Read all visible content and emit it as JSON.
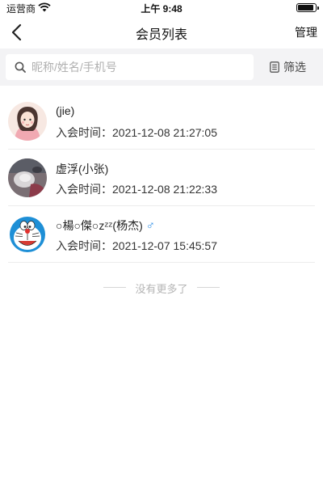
{
  "status_bar": {
    "carrier": "运营商",
    "time": "上午 9:48"
  },
  "nav": {
    "title": "会员列表",
    "manage_label": "管理"
  },
  "search": {
    "placeholder": "昵称/姓名/手机号",
    "value": "",
    "filter_label": "筛选"
  },
  "members": [
    {
      "name": "(jie)",
      "joined": "入会时间：2021-12-08 21:27:05",
      "avatar": "girl-illustration-avatar"
    },
    {
      "name": "虚浮(小张)",
      "joined": "入会时间：2021-12-08 21:22:33",
      "avatar": "photo-avatar"
    },
    {
      "name": "○楊○傑○zᶻᶻ(杨杰)",
      "gender": "♂",
      "joined": "入会时间：2021-12-07 15:45:57",
      "avatar": "doraemon-avatar"
    }
  ],
  "list_end_text": "没有更多了",
  "colors": {
    "gender_male": "#2f8fe6",
    "search_bar_bg": "#f3f3f5",
    "divider": "#ececec"
  }
}
